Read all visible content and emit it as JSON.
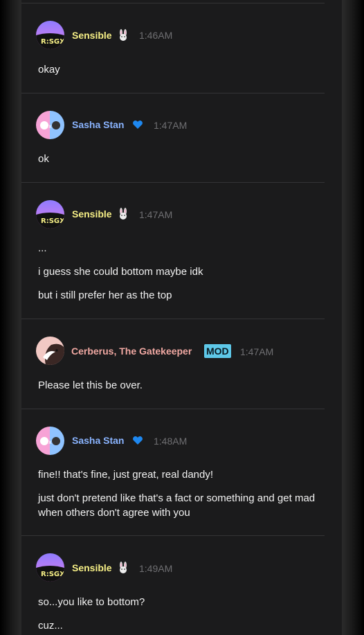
{
  "messages": [
    {
      "author": "Sensible",
      "author_icon": "bunny-emoji-icon",
      "time": "1:46AM",
      "lines": [
        "okay"
      ]
    },
    {
      "author": "Sasha Stan",
      "author_icon": "blue-heart-icon",
      "time": "1:47AM",
      "lines": [
        "ok"
      ]
    },
    {
      "author": "Sensible",
      "author_icon": "bunny-emoji-icon",
      "time": "1:47AM",
      "lines": [
        "...",
        "i guess she could bottom maybe idk",
        "but i still prefer her as the top"
      ]
    },
    {
      "author": "Cerberus, The Gatekeeper",
      "role_badge": "MOD",
      "time": "1:47AM",
      "lines": [
        "Please let this be over."
      ]
    },
    {
      "author": "Sasha Stan",
      "author_icon": "blue-heart-icon",
      "time": "1:48AM",
      "lines": [
        "fine!! that's fine, just great, real dandy!",
        "just don't pretend like that's a fact or something and get mad when others don't agree with you"
      ]
    },
    {
      "author": "Sensible",
      "author_icon": "bunny-emoji-icon",
      "time": "1:49AM",
      "lines": [
        "so...you like to bottom?",
        "cuz..."
      ]
    }
  ],
  "colors": {
    "panel_bg": "#1b1b1c",
    "sensible_name": "#f6ef86",
    "sasha_name": "#8ab4ff",
    "cerberus_name": "#f0a8a2",
    "mod_badge": "#5ec8e8",
    "timestamp": "#6f6f72",
    "message_text": "#f1f1f1"
  }
}
